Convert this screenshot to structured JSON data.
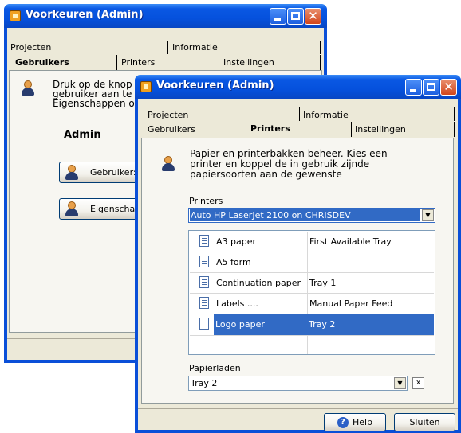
{
  "back_window": {
    "title": "Voorkeuren (Admin)",
    "tabs_row1": [
      "Projecten",
      "Informatie"
    ],
    "tabs_row2": [
      "Gebruikers",
      "Printers",
      "Instellingen"
    ],
    "description": [
      "Druk op de knop",
      "gebruiker aan te",
      "Eigenschappen o"
    ],
    "admin_label": "Admin",
    "user_button": "Gebruiker:",
    "properties_button": "Eigenschap"
  },
  "front_window": {
    "title": "Voorkeuren (Admin)",
    "tabs_row1": [
      "Projecten",
      "Informatie"
    ],
    "tabs_row2": [
      "Gebruikers",
      "Printers",
      "Instellingen"
    ],
    "description": [
      "Papier en printerbakken beheer. Kies een",
      "printer en koppel de in gebruik zijnde",
      "papiersoorten aan de gewenste"
    ],
    "printers_label": "Printers",
    "printer_selected": "Auto HP LaserJet 2100 on CHRISDEV",
    "papers": [
      {
        "name": "A3 paper",
        "tray": "First Available Tray"
      },
      {
        "name": "A5 form",
        "tray": ""
      },
      {
        "name": "Continuation paper",
        "tray": "Tray 1"
      },
      {
        "name": "Labels ....",
        "tray": "Manual Paper Feed"
      },
      {
        "name": "Logo paper",
        "tray": "Tray 2"
      }
    ],
    "papierladen_label": "Papierladen",
    "tray_selected": "Tray 2",
    "clear_glyph": "x",
    "help_button": "Help",
    "close_button": "Sluiten"
  },
  "colors": {
    "titlebar": "#0551dd",
    "selection": "#316ac5",
    "client": "#ece9d8"
  }
}
